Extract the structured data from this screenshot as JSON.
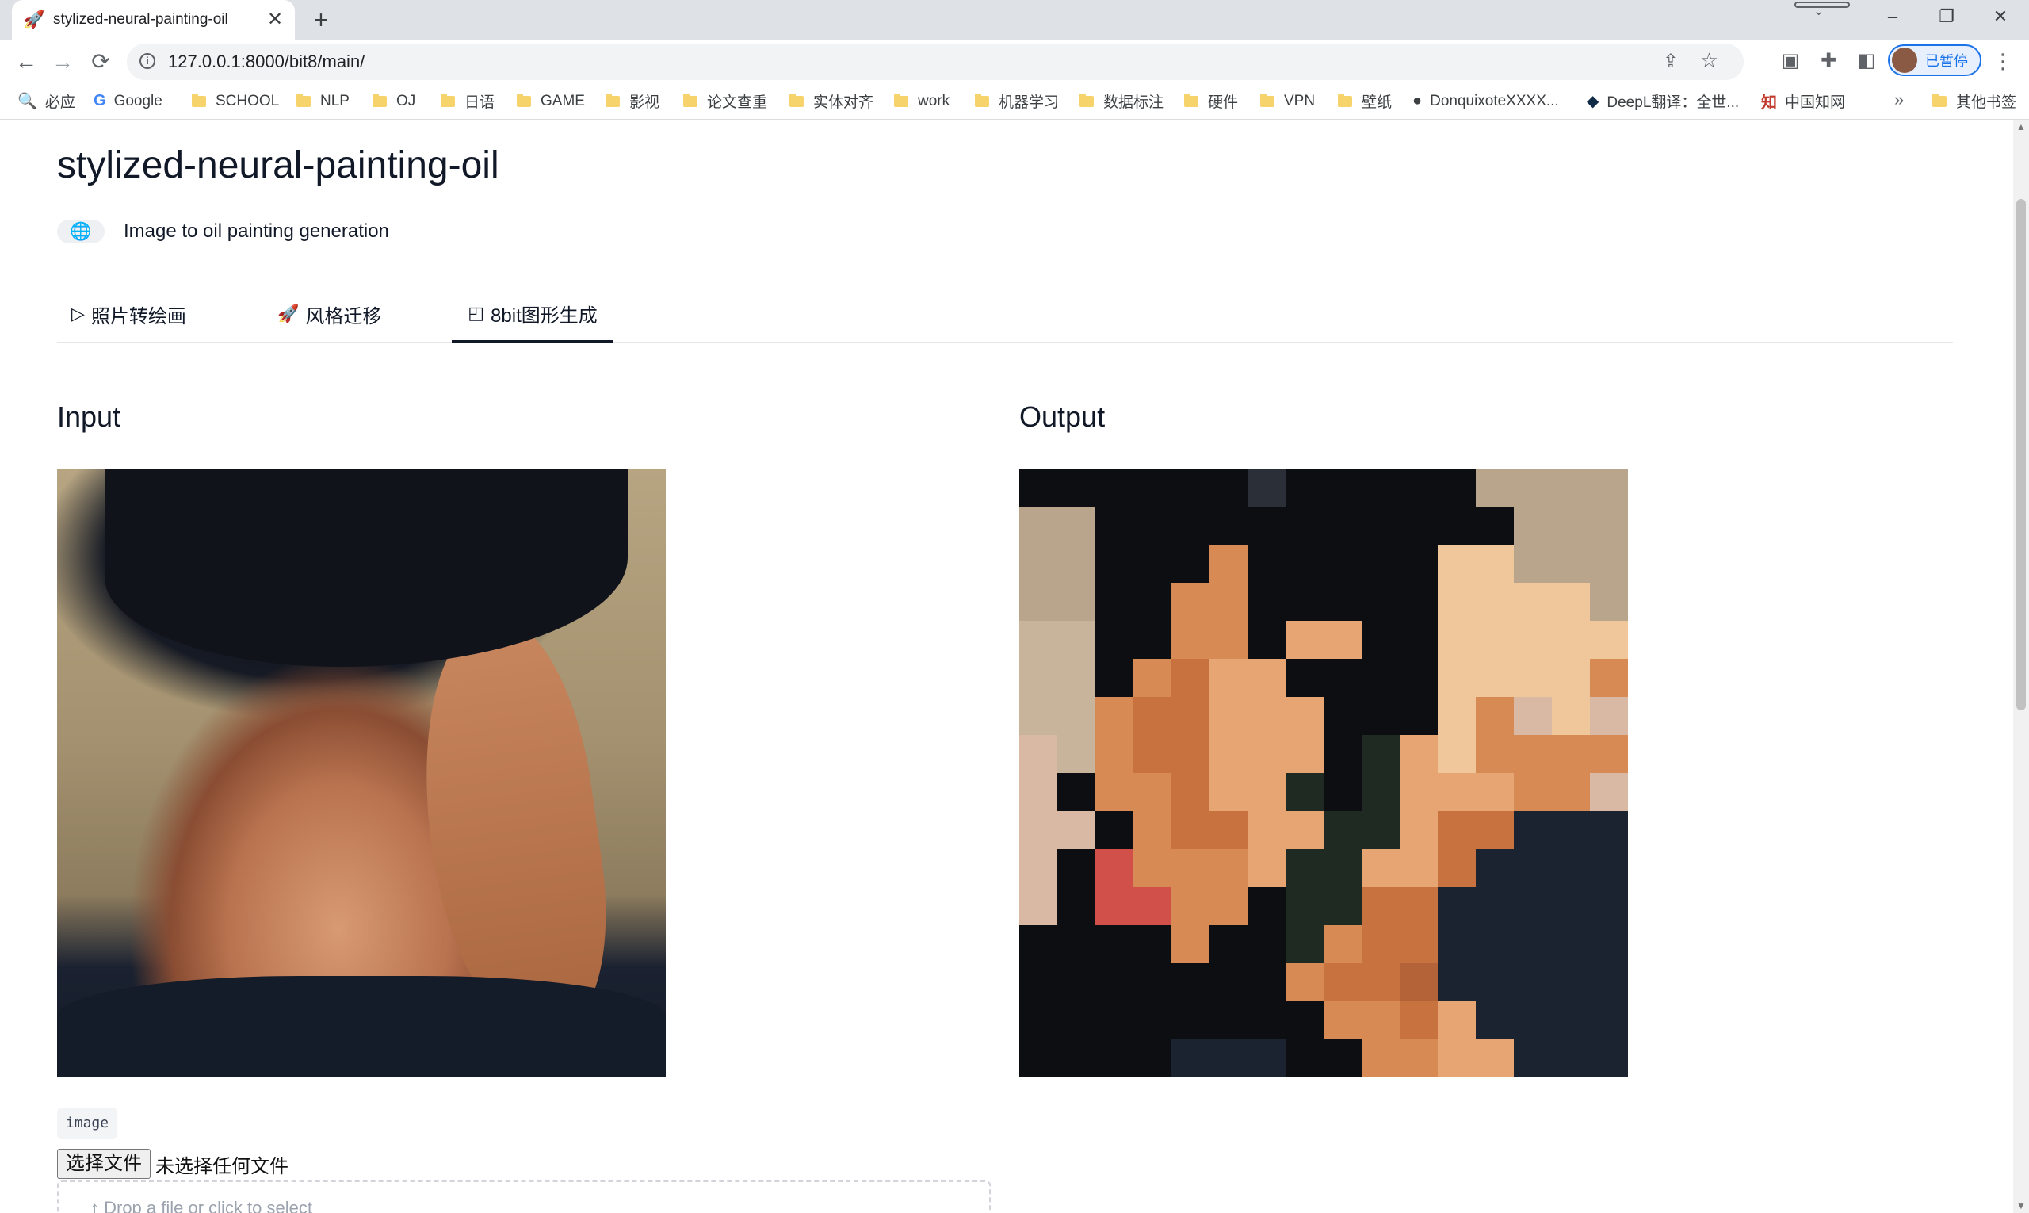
{
  "browser": {
    "tab_title": "stylized-neural-painting-oil",
    "tab_favicon": "🚀",
    "new_tab_glyph": "+",
    "close_glyph": "✕",
    "url": "127.0.0.1:8000/bit8/main/",
    "profile_label": "已暂停",
    "nav": {
      "back": "←",
      "forward": "→",
      "reload": "⟳"
    },
    "window": {
      "minimize": "–",
      "restore": "❐",
      "close": "✕"
    }
  },
  "bookmarks": [
    {
      "label": "必应",
      "icon": "search-icon",
      "glyph": "🔍"
    },
    {
      "label": "Google",
      "icon": "google-icon",
      "glyph": "G"
    },
    {
      "label": "SCHOOL",
      "icon": "folder-icon"
    },
    {
      "label": "NLP",
      "icon": "folder-icon"
    },
    {
      "label": "OJ",
      "icon": "folder-icon"
    },
    {
      "label": "日语",
      "icon": "folder-icon"
    },
    {
      "label": "GAME",
      "icon": "folder-icon"
    },
    {
      "label": "影视",
      "icon": "folder-icon"
    },
    {
      "label": "论文查重",
      "icon": "folder-icon"
    },
    {
      "label": "实体对齐",
      "icon": "folder-icon"
    },
    {
      "label": "work",
      "icon": "folder-icon"
    },
    {
      "label": "机器学习",
      "icon": "folder-icon"
    },
    {
      "label": "数据标注",
      "icon": "folder-icon"
    },
    {
      "label": "硬件",
      "icon": "folder-icon"
    },
    {
      "label": "VPN",
      "icon": "folder-icon"
    },
    {
      "label": "壁纸",
      "icon": "folder-icon"
    },
    {
      "label": "DonquixoteXXXX...",
      "icon": "github-icon",
      "glyph": "●"
    },
    {
      "label": "DeepL翻译：全世...",
      "icon": "deepl-icon",
      "glyph": "◆"
    },
    {
      "label": "中国知网",
      "icon": "cnki-icon",
      "glyph": "知"
    },
    {
      "label": "其他书签",
      "icon": "folder-icon"
    }
  ],
  "bookmarks_overflow": "»",
  "page": {
    "title": "stylized-neural-painting-oil",
    "description": "Image to oil painting generation",
    "tabs": [
      {
        "label": "照片转绘画",
        "icon": "play-icon",
        "glyph": "▷"
      },
      {
        "label": "风格迁移",
        "icon": "rocket-icon",
        "glyph": "🚀"
      },
      {
        "label": "8bit图形生成",
        "icon": "image-icon",
        "glyph": "◰"
      }
    ],
    "active_tab": "8bit图形生成",
    "input_label": "Input",
    "output_label": "Output",
    "upload_tag": "image",
    "file_button": "选择文件",
    "file_status": "未选择任何文件",
    "dropzone_text": "↑ Drop a file or click to select"
  },
  "colors": {
    "accent": "#1a73e8",
    "text": "#111827",
    "tab_underline": "#111827"
  }
}
